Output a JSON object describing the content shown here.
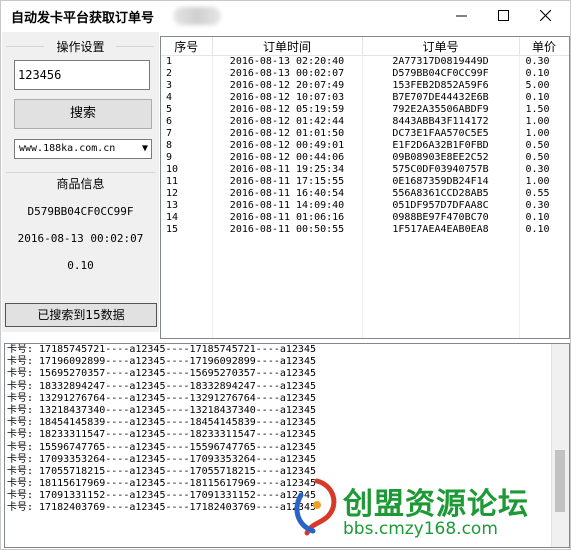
{
  "window": {
    "title": "自动发卡平台获取订单号"
  },
  "settings": {
    "title": "操作设置",
    "input_value": "123456",
    "search_label": "搜索",
    "site_selected": "www.188ka.com.cn"
  },
  "product": {
    "title": "商品信息",
    "order_id": "D579BB04CF0CC99F",
    "time": "2016-08-13 00:02:07",
    "price": "0.10"
  },
  "status": {
    "label": "已搜索到15数据"
  },
  "table": {
    "headers": [
      "序号",
      "订单时间",
      "订单号",
      "单价"
    ],
    "rows": [
      [
        "1",
        "2016-08-13 02:20:40",
        "2A77317D0819449D",
        "0.30"
      ],
      [
        "2",
        "2016-08-13 00:02:07",
        "D579BB04CF0CC99F",
        "0.10"
      ],
      [
        "3",
        "2016-08-12 20:07:49",
        "153FEB2D852A59F6",
        "5.00"
      ],
      [
        "4",
        "2016-08-12 10:07:03",
        "B7E707DE44432E6B",
        "0.10"
      ],
      [
        "5",
        "2016-08-12 05:19:59",
        "792E2A35506ABDF9",
        "1.50"
      ],
      [
        "6",
        "2016-08-12 01:42:44",
        "8443ABB43F114172",
        "1.00"
      ],
      [
        "7",
        "2016-08-12 01:01:50",
        "DC73E1FAA570C5E5",
        "1.00"
      ],
      [
        "8",
        "2016-08-12 00:49:01",
        "E1F2D6A32B1F0FBD",
        "0.50"
      ],
      [
        "9",
        "2016-08-12 00:44:06",
        "09B08903E8EE2C52",
        "0.50"
      ],
      [
        "10",
        "2016-08-11 19:25:34",
        "575C0DF03940757B",
        "0.30"
      ],
      [
        "11",
        "2016-08-11 17:15:55",
        "0E1687359DB24F14",
        "1.00"
      ],
      [
        "12",
        "2016-08-11 16:40:54",
        "556A8361CCD28AB5",
        "0.55"
      ],
      [
        "13",
        "2016-08-11 14:09:40",
        "051DF957D7DFAA8C",
        "0.30"
      ],
      [
        "14",
        "2016-08-11 01:06:16",
        "0988BE97F470BC70",
        "0.10"
      ],
      [
        "15",
        "2016-08-11 00:50:55",
        "1F517AEA4EAB0EA8",
        "0.10"
      ]
    ]
  },
  "log": {
    "lines": [
      "卡号: 17185745721----a12345----17185745721----a12345",
      "卡号: 17196092899----a12345----17196092899----a12345",
      "卡号: 15695270357----a12345----15695270357----a12345",
      "卡号: 18332894247----a12345----18332894247----a12345",
      "卡号: 13291276764----a12345----13291276764----a12345",
      "卡号: 13218437340----a12345----13218437340----a12345",
      "卡号: 18454145839----a12345----18454145839----a12345",
      "卡号: 18233311547----a12345----18233311547----a12345",
      "卡号: 15596747765----a12345----15596747765----a12345",
      "卡号: 17093353264----a12345----17093353264----a12345",
      "卡号: 17055718215----a12345----17055718215----a12345",
      "卡号: 18115617969----a12345----18115617969----a12345",
      "卡号: 17091331152----a12345----17091331152----a12345",
      "卡号: 17182403769----a12345----17182403769----a12345"
    ]
  },
  "watermark": {
    "name": "创盟资源论坛",
    "url": "bbs.cmzy168.com"
  },
  "colors": {
    "watermark_green": "#1d9a36",
    "button_face": "#e1e1e1",
    "panel_bg": "#f0f0f0"
  }
}
